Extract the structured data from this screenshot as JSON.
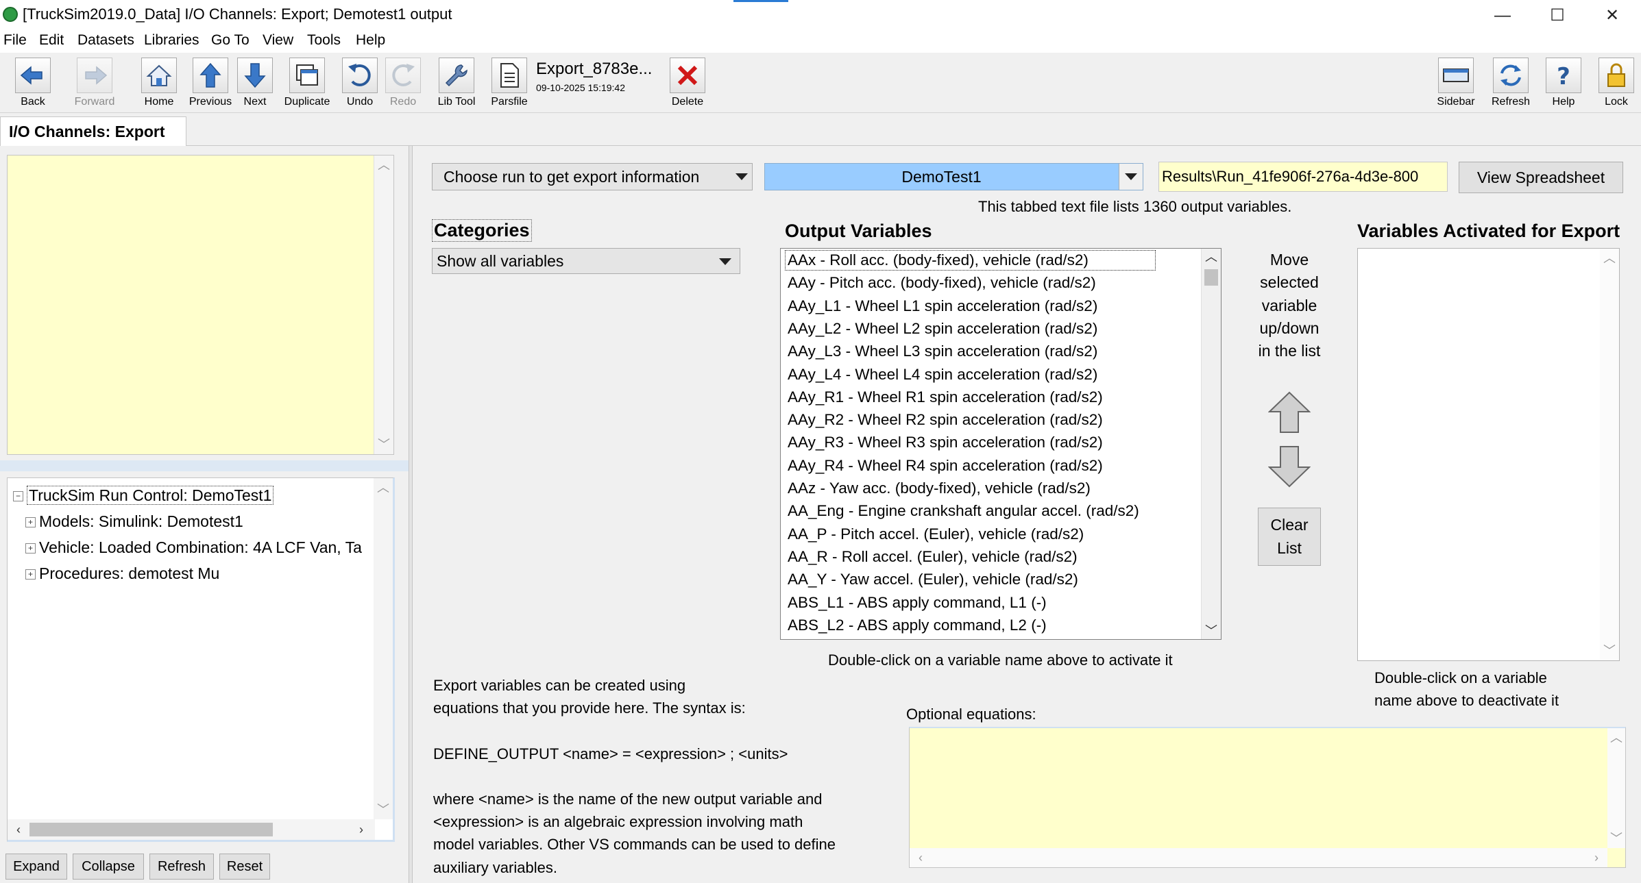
{
  "window": {
    "title": "[TruckSim2019.0_Data] I/O Channels: Export; Demotest1 output",
    "minimize": "—",
    "maximize": "☐",
    "close": "✕"
  },
  "menu": [
    "File",
    "Edit",
    "Datasets",
    "Libraries",
    "Go To",
    "View",
    "Tools",
    "Help"
  ],
  "toolbar": {
    "back": "Back",
    "forward": "Forward",
    "home": "Home",
    "previous": "Previous",
    "next": "Next",
    "duplicate": "Duplicate",
    "undo": "Undo",
    "redo": "Redo",
    "lib_tool": "Lib Tool",
    "parsfile": "Parsfile",
    "dataset_name": "Export_8783e...",
    "dataset_date": "09-10-2025 15:19:42",
    "delete": "Delete",
    "sidebar": "Sidebar",
    "refresh": "Refresh",
    "help": "Help",
    "lock": "Lock"
  },
  "tab": {
    "label": "I/O Channels: Export"
  },
  "tree": {
    "root": "TruckSim Run Control: DemoTest1",
    "children": [
      "Models: Simulink: Demotest1",
      "Vehicle: Loaded Combination: 4A LCF Van, Ta",
      "Procedures: demotest Mu"
    ]
  },
  "tree_buttons": {
    "expand": "Expand",
    "collapse": "Collapse",
    "refresh": "Refresh",
    "reset": "Reset"
  },
  "run_selector": {
    "choose_label": "Choose run to get export information",
    "selected_run": "DemoTest1",
    "results_path": "Results\\Run_41fe906f-276a-4d3e-800",
    "view_spreadsheet": "View Spreadsheet",
    "info": "This tabbed text file lists 1360 output variables."
  },
  "categories": {
    "header": "Categories",
    "selected": "Show all variables"
  },
  "output_variables": {
    "header": "Output Variables",
    "items": [
      "AAx - Roll acc. (body-fixed), vehicle (rad/s2)",
      "AAy - Pitch acc. (body-fixed), vehicle (rad/s2)",
      "AAy_L1 - Wheel L1 spin acceleration (rad/s2)",
      "AAy_L2 - Wheel L2 spin acceleration (rad/s2)",
      "AAy_L3 - Wheel L3 spin acceleration (rad/s2)",
      "AAy_L4 - Wheel L4 spin acceleration (rad/s2)",
      "AAy_R1 - Wheel R1 spin acceleration (rad/s2)",
      "AAy_R2 - Wheel R2 spin acceleration (rad/s2)",
      "AAy_R3 - Wheel R3 spin acceleration (rad/s2)",
      "AAy_R4 - Wheel R4 spin acceleration (rad/s2)",
      "AAz - Yaw acc. (body-fixed), vehicle (rad/s2)",
      "AA_Eng - Engine crankshaft angular accel. (rad/s2)",
      "AA_P - Pitch accel. (Euler), vehicle (rad/s2)",
      "AA_R - Roll accel. (Euler), vehicle (rad/s2)",
      "AA_Y - Yaw accel. (Euler), vehicle (rad/s2)",
      "ABS_L1 - ABS apply command, L1 (-)",
      "ABS_L2 - ABS apply command, L2 (-)"
    ],
    "hint": "Double-click on a variable name above to activate it"
  },
  "move": {
    "lines": [
      "Move",
      "selected",
      "variable",
      "up/down",
      "in the list"
    ],
    "clear_list": [
      "Clear",
      "List"
    ]
  },
  "activated": {
    "header": "Variables Activated for Export",
    "hint_lines": [
      "Double-click on a variable",
      "name above to deactivate it"
    ]
  },
  "equations": {
    "explanation": [
      "Export variables can be created using",
      "equations that you provide here. The syntax is:",
      "",
      "DEFINE_OUTPUT <name> = <expression> ; <units>",
      "",
      "where <name> is the name of the new output variable and",
      "<expression> is an algebraic expression involving math",
      "model variables. Other VS commands can be used to define",
      "auxiliary variables."
    ],
    "label": "Optional equations:"
  }
}
